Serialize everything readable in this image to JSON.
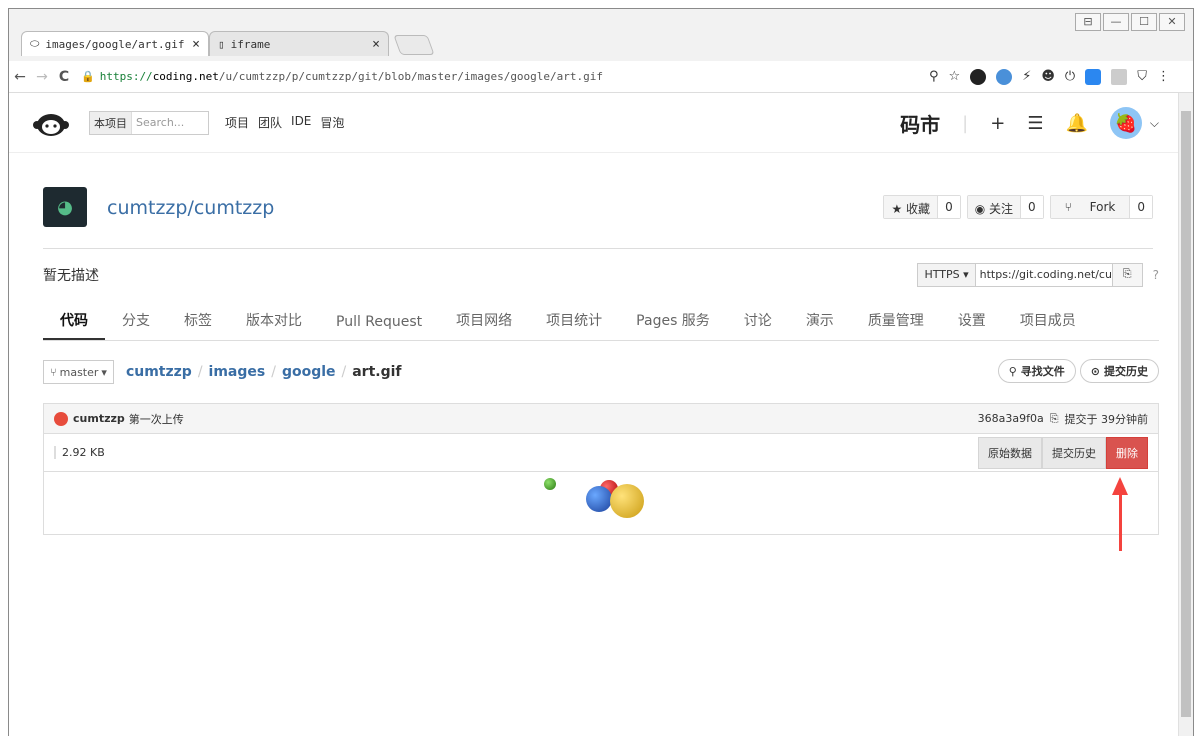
{
  "browser": {
    "tabs": [
      {
        "title": "images/google/art.gif",
        "close": "×"
      },
      {
        "title": "iframe",
        "close": "×"
      }
    ],
    "window_buttons": [
      "⊟",
      "—",
      "☐",
      "✕"
    ],
    "url": {
      "scheme": "https://",
      "host": "coding.net",
      "path": "/u/cumtzzp/p/cumtzzp/git/blob/master/images/google/art.gif"
    },
    "nav": {
      "back": "←",
      "forward": "→",
      "reload": "C"
    }
  },
  "header": {
    "search_scope": "本项目",
    "search_placeholder": "Search...",
    "nav": [
      "项目",
      "团队",
      "IDE",
      "冒泡"
    ],
    "mart": "码市"
  },
  "repo": {
    "name": "cumtzzp/cumtzzp",
    "star_label": "★ 收藏",
    "star_count": "0",
    "watch_label": "◉ 关注",
    "watch_count": "0",
    "fork_label": "Fork",
    "fork_count": "0",
    "description": "暂无描述",
    "clone_protocol": "HTTPS ▾",
    "clone_url": "https://git.coding.net/cu"
  },
  "tabs": [
    "代码",
    "分支",
    "标签",
    "版本对比",
    "Pull Request",
    "项目网络",
    "项目统计",
    "Pages 服务",
    "讨论",
    "演示",
    "质量管理",
    "设置",
    "项目成员"
  ],
  "breadcrumb": {
    "branch": "master",
    "parts": [
      "cumtzzp",
      "images",
      "google"
    ],
    "file": "art.gif",
    "find_file": "寻找文件",
    "history": "提交历史"
  },
  "file": {
    "author": "cumtzzp",
    "message": "第一次上传",
    "commit": "368a3a9f0a",
    "time": "提交于 39分钟前",
    "size": "2.92 KB",
    "raw": "原始数据",
    "history": "提交历史",
    "delete": "删除"
  }
}
